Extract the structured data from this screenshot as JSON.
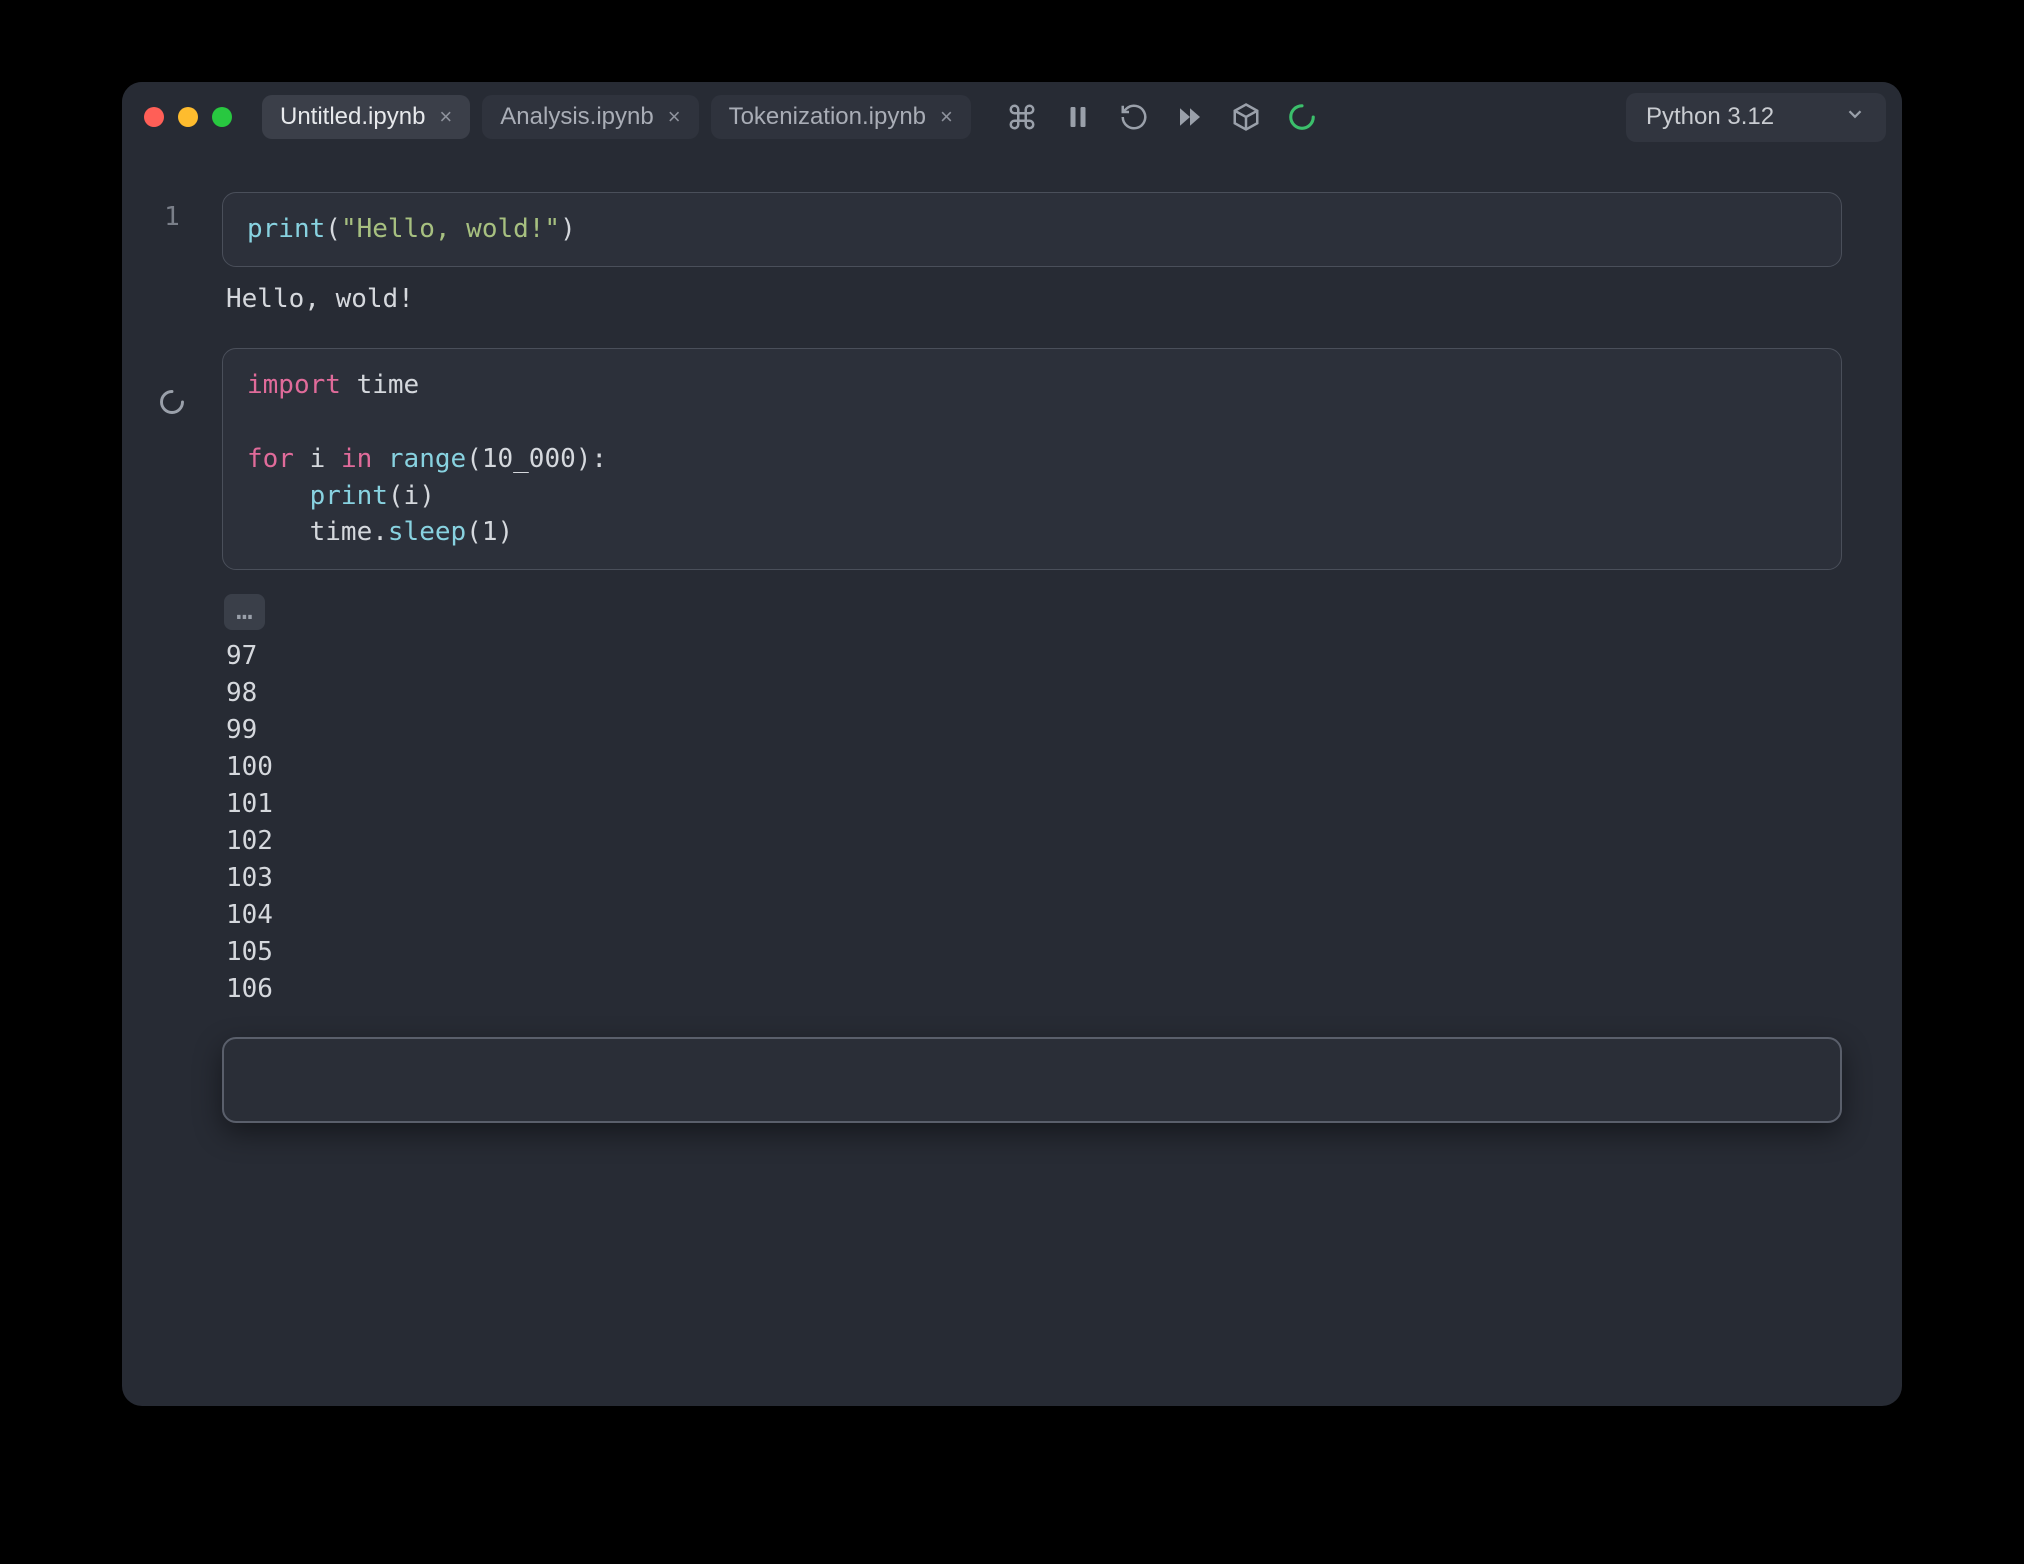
{
  "tabs": [
    {
      "label": "Untitled.ipynb",
      "active": true
    },
    {
      "label": "Analysis.ipynb",
      "active": false
    },
    {
      "label": "Tokenization.ipynb",
      "active": false
    }
  ],
  "kernel": {
    "label": "Python 3.12"
  },
  "cells": {
    "cell1": {
      "exec_count": "1",
      "code_tokens": [
        {
          "t": "print",
          "c": "tok-fn"
        },
        {
          "t": "(",
          "c": "tok-punct"
        },
        {
          "t": "\"Hello, wold!\"",
          "c": "tok-str"
        },
        {
          "t": ")",
          "c": "tok-punct"
        }
      ],
      "output": "Hello, wold!"
    },
    "cell2": {
      "running": true,
      "code_lines": [
        [
          {
            "t": "import",
            "c": "tok-kw"
          },
          {
            "t": " time",
            "c": "tok-mod"
          }
        ],
        [],
        [
          {
            "t": "for",
            "c": "tok-kw"
          },
          {
            "t": " i ",
            "c": "tok-mod"
          },
          {
            "t": "in",
            "c": "tok-kw"
          },
          {
            "t": " ",
            "c": "tok-mod"
          },
          {
            "t": "range",
            "c": "tok-fn"
          },
          {
            "t": "(",
            "c": "tok-punct"
          },
          {
            "t": "10_000",
            "c": "tok-num"
          },
          {
            "t": "):",
            "c": "tok-punct"
          }
        ],
        [
          {
            "t": "    ",
            "c": "tok-mod"
          },
          {
            "t": "print",
            "c": "tok-fn"
          },
          {
            "t": "(i)",
            "c": "tok-punct"
          }
        ],
        [
          {
            "t": "    time.",
            "c": "tok-mod"
          },
          {
            "t": "sleep",
            "c": "tok-fn"
          },
          {
            "t": "(",
            "c": "tok-punct"
          },
          {
            "t": "1",
            "c": "tok-num"
          },
          {
            "t": ")",
            "c": "tok-punct"
          }
        ]
      ],
      "truncated_marker": "…",
      "output_lines": [
        "97",
        "98",
        "99",
        "100",
        "101",
        "102",
        "103",
        "104",
        "105",
        "106"
      ]
    }
  }
}
